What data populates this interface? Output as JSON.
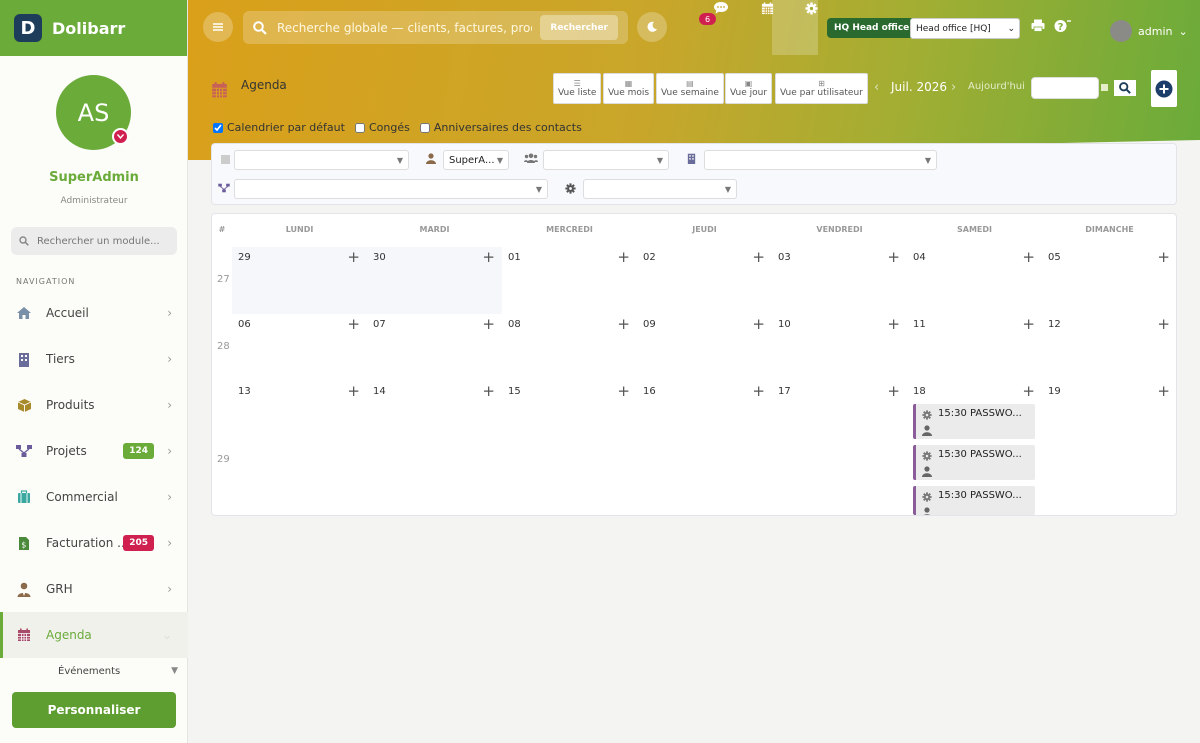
{
  "brand": {
    "logo_letter": "D",
    "name": "Dolibarr"
  },
  "user": {
    "initials": "AS",
    "name": "SuperAdmin",
    "role": "Administrateur"
  },
  "sidebar": {
    "search_placeholder": "Rechercher un module...",
    "nav_title": "NAVIGATION",
    "items": [
      {
        "label": "Accueil",
        "icon": "home-icon",
        "color": "#7a8fa8"
      },
      {
        "label": "Tiers",
        "icon": "building-icon",
        "color": "#6a6c9a"
      },
      {
        "label": "Produits",
        "icon": "box-icon",
        "color": "#a88a2a"
      },
      {
        "label": "Projets",
        "icon": "sitemap-icon",
        "color": "#6a5c9a",
        "badge": "124",
        "badge_color": "#6aab3a"
      },
      {
        "label": "Commercial",
        "icon": "suitcase-icon",
        "color": "#3aa8a0"
      },
      {
        "label": "Facturation ...",
        "icon": "invoice-icon",
        "color": "#4a8a3a",
        "badge": "205",
        "badge_color": "#d02050"
      },
      {
        "label": "GRH",
        "icon": "user-tie-icon",
        "color": "#8a6a4a"
      },
      {
        "label": "Agenda",
        "icon": "calendar-icon",
        "color": "#a84a6a"
      }
    ],
    "sub_item": "Événements",
    "personalise": "Personnaliser"
  },
  "header": {
    "search_placeholder": "Recherche globale — clients, factures, produits...",
    "search_button": "Rechercher",
    "messages_badge": "6",
    "entity_badge": "HQ Head office",
    "entity_select": "Head office [HQ]",
    "user": "admin"
  },
  "page": {
    "title": "Agenda",
    "views": [
      "Vue liste",
      "Vue mois",
      "Vue semaine",
      "Vue jour",
      "Vue par utilisateur"
    ],
    "period": "Juil. 2026",
    "today": "Aujourd'hui",
    "checks": [
      {
        "label": "Calendrier par défaut",
        "checked": true
      },
      {
        "label": "Congés",
        "checked": false
      },
      {
        "label": "Anniversaires des contacts",
        "checked": false
      }
    ]
  },
  "filters": {
    "user_select": "SuperA..."
  },
  "calendar": {
    "days": [
      "LUNDI",
      "MARDI",
      "MERCREDI",
      "JEUDI",
      "VENDREDI",
      "SAMEDI",
      "DIMANCHE"
    ],
    "hash": "#",
    "weeks": [
      {
        "num": "27",
        "days": [
          "29",
          "30",
          "01",
          "02",
          "03",
          "04",
          "05"
        ]
      },
      {
        "num": "28",
        "days": [
          "06",
          "07",
          "08",
          "09",
          "10",
          "11",
          "12"
        ]
      },
      {
        "num": "29",
        "days": [
          "13",
          "14",
          "15",
          "16",
          "17",
          "18",
          "19"
        ]
      }
    ],
    "events": [
      "15:30 PASSWO...",
      "15:30 PASSWO...",
      "15:30 PASSWO..."
    ]
  }
}
